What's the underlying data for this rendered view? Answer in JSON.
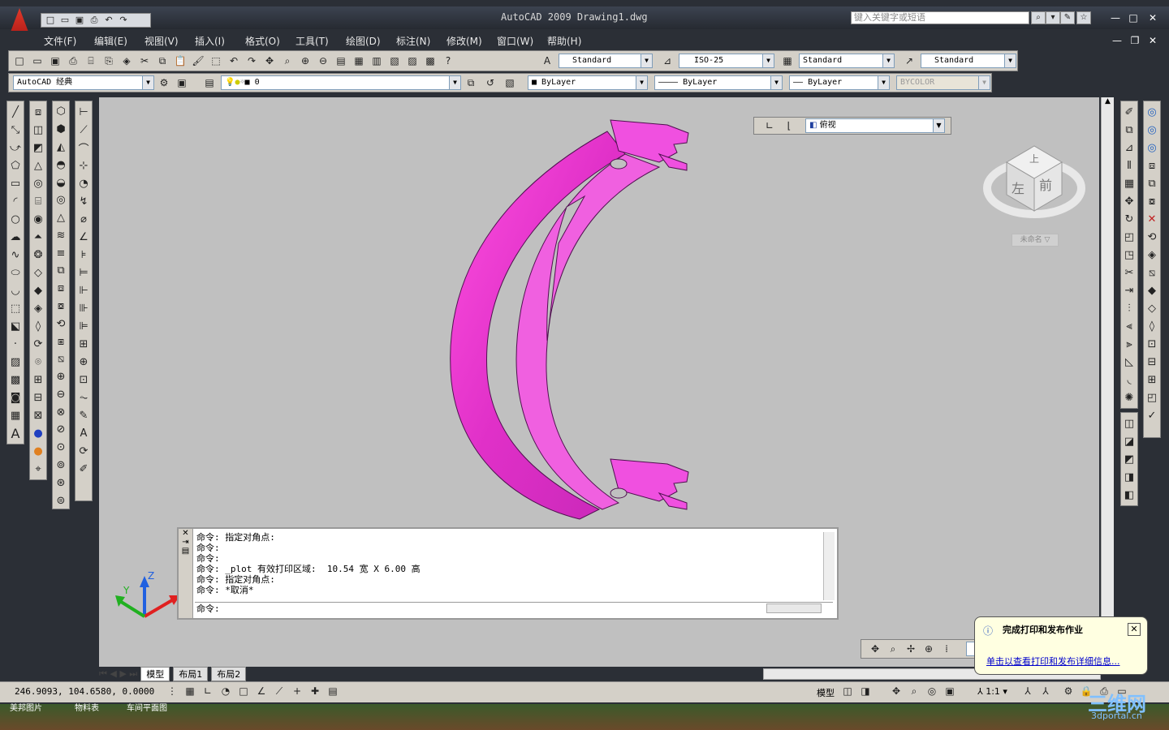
{
  "app": {
    "title": "AutoCAD 2009  Drawing1.dwg"
  },
  "search": {
    "placeholder": "键入关键字或短语"
  },
  "menu": [
    "文件(F)",
    "编辑(E)",
    "视图(V)",
    "插入(I)",
    "格式(O)",
    "工具(T)",
    "绘图(D)",
    "标注(N)",
    "修改(M)",
    "窗口(W)",
    "帮助(H)"
  ],
  "toolbar": {
    "text_style": "Standard",
    "dim_style": "ISO-25",
    "table_style": "Standard",
    "multileader_style": "Standard",
    "workspace": "AutoCAD 经典",
    "layer": "0",
    "color": "ByLayer",
    "linetype": "ByLayer",
    "lineweight": "ByLayer",
    "plotstyle": "BYCOLOR"
  },
  "view": {
    "current": "俯视"
  },
  "viewcube": {
    "top": "上",
    "left": "左",
    "front": "前",
    "named": "未命名"
  },
  "command": {
    "lines": [
      "命令: 指定对角点:",
      "命令:",
      "命令:",
      "命令: _plot 有效打印区域:  10.54 宽 X 6.00 高",
      "命令: 指定对角点:",
      "命令: *取消*"
    ],
    "prompt": "命令:"
  },
  "tabs": [
    "模型",
    "布局1",
    "布局2"
  ],
  "status": {
    "coords": "246.9093,  104.6580,  0.0000",
    "model": "模型",
    "scale": "1:1"
  },
  "balloon": {
    "title": "完成打印和发布作业",
    "link": "单击以查看打印和发布详细信息..."
  },
  "taskbar": [
    "美邦图片",
    "物料表",
    "车间平面图"
  ],
  "watermark": {
    "name": "三维网",
    "url": "3dportal.cn"
  },
  "colors": {
    "model": "#e040d0",
    "background": "#c0c0c0",
    "accent": "#d02020"
  }
}
